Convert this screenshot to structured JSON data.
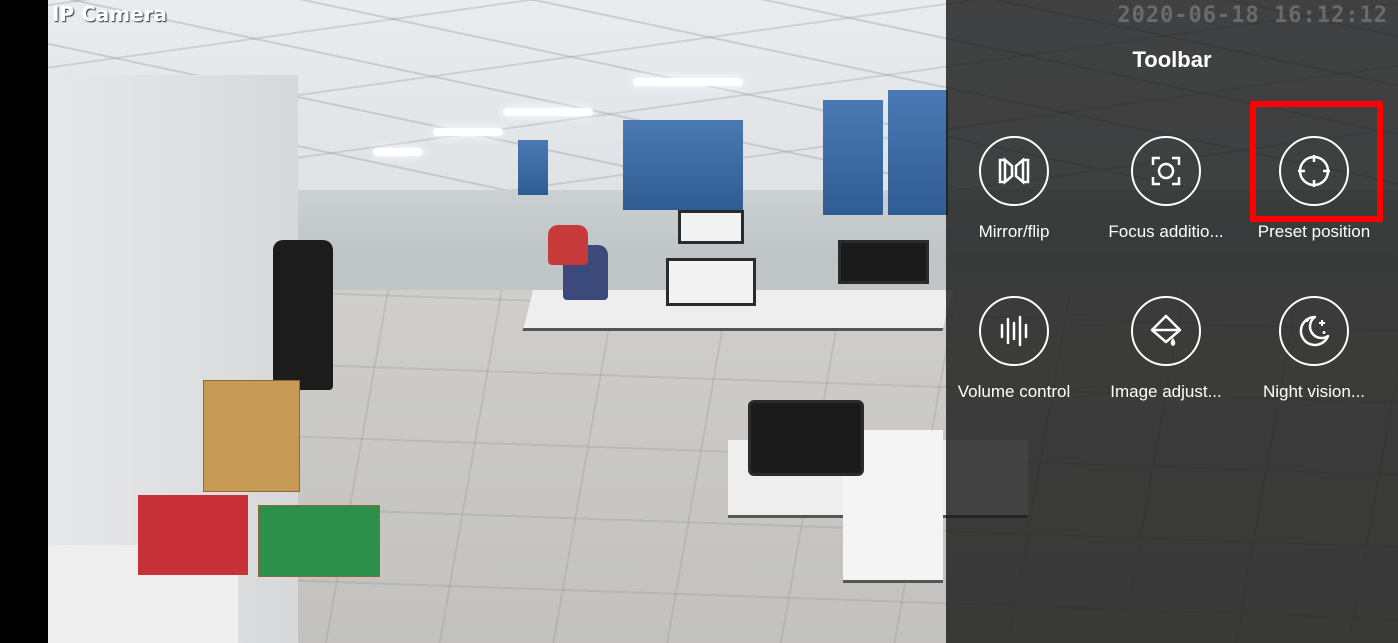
{
  "camera": {
    "title": "IP Camera",
    "timestamp": "2020-06-18 16:12:12"
  },
  "toolbar": {
    "title": "Toolbar",
    "highlight_color": "#ff0000",
    "tools": [
      {
        "label": "Mirror/flip",
        "icon": "mirror-flip-icon"
      },
      {
        "label": "Focus additio...",
        "icon": "focus-icon"
      },
      {
        "label": "Preset position",
        "icon": "preset-position-icon"
      },
      {
        "label": "Volume control",
        "icon": "volume-control-icon"
      },
      {
        "label": "Image adjust...",
        "icon": "image-adjust-icon"
      },
      {
        "label": "Night vision...",
        "icon": "night-vision-icon"
      }
    ]
  }
}
